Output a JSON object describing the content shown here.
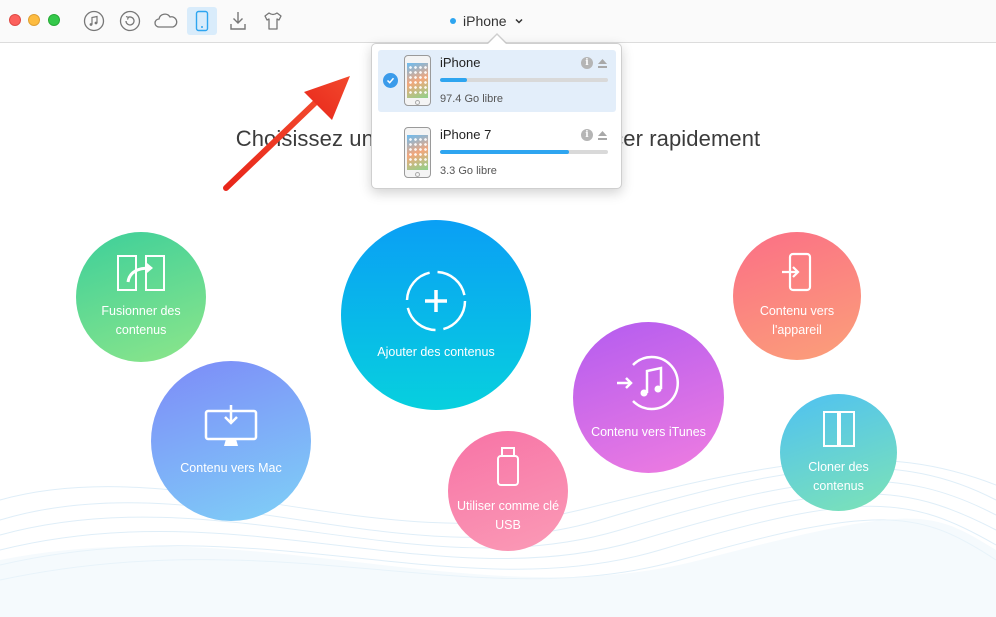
{
  "toolbar": {
    "buttons": [
      "itunes-library-icon",
      "backup-restore-icon",
      "icloud-icon",
      "device-icon",
      "download-icon",
      "shirt-icon"
    ],
    "active_button": "device-icon",
    "device_selector": {
      "label": "iPhone",
      "dot_color": "#2ea5f0"
    }
  },
  "headline": "Choisissez un raccourci pour commencer rapidement",
  "actions": {
    "merge": "Fusionner des contenus",
    "to_mac": "Contenu vers Mac",
    "add": "Ajouter des contenus",
    "usb": "Utiliser comme clé USB",
    "to_itunes": "Contenu vers iTunes",
    "to_device": "Contenu vers l'appareil",
    "clone": "Cloner des contenus"
  },
  "dropdown": {
    "devices": [
      {
        "name": "iPhone",
        "free": "97.4 Go libre",
        "used_fraction": 0.16,
        "selected": true
      },
      {
        "name": "iPhone 7",
        "free": "3.3 Go libre",
        "used_fraction": 0.77,
        "selected": false
      }
    ]
  },
  "colors": {
    "accent": "#2ea5f0",
    "annotation_arrow": "#f0331e"
  }
}
